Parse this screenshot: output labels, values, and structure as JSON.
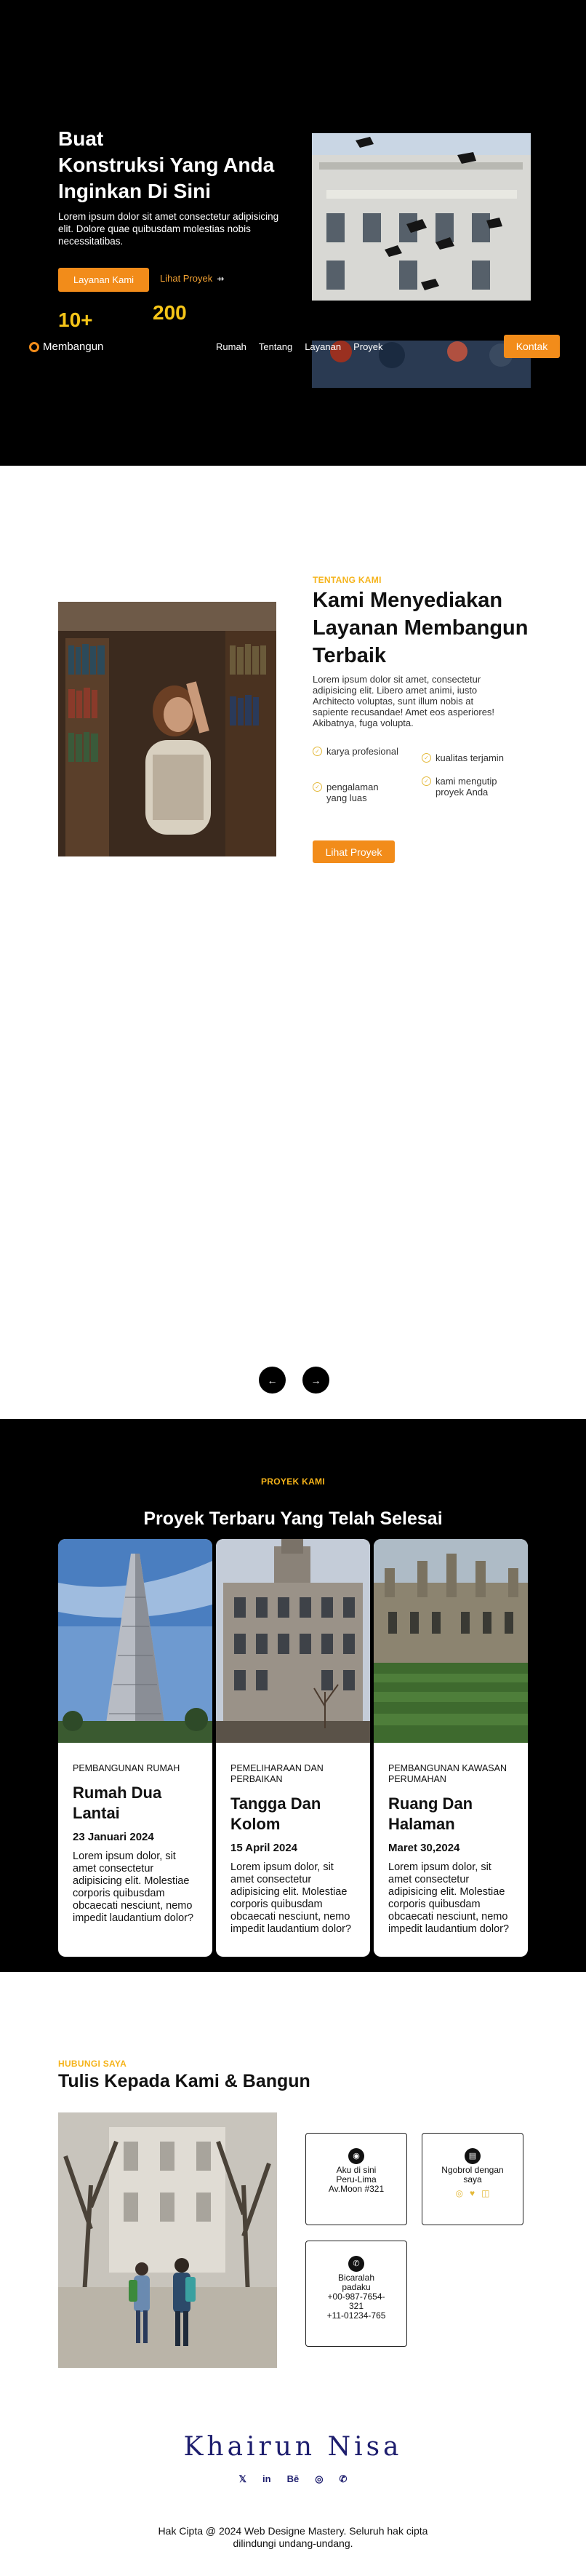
{
  "hero": {
    "title_lines": [
      "Buat",
      "Konstruksi Yang Anda",
      "Inginkan Di Sini"
    ],
    "description": "Lorem ipsum dolor sit amet consectetur adipisicing elit. Dolore quae quibusdam molestias nobis necessitatibas.",
    "primary_button": "Layanan Kami",
    "secondary_link": "Lihat Proyek",
    "stats": [
      "10+",
      "200"
    ]
  },
  "navbar": {
    "brand": "Membangun",
    "links": [
      "Rumah",
      "Tentang",
      "Layanan",
      "Proyek"
    ],
    "cta": "Kontak"
  },
  "about": {
    "eyebrow": "TENTANG KAMI",
    "title": "Kami Menyediakan Layanan Membangun Terbaik",
    "description": "Lorem ipsum dolor sit amet, consectetur adipisicing elit. Libero amet animi, iusto Architecto voluptas, sunt illum nobis at sapiente recusandae! Amet eos asperiores! Akibatnya, fuga volupta.",
    "features": [
      "karya profesional",
      "kualitas terjamin",
      "pengalaman yang luas",
      "kami mengutip proyek Anda"
    ],
    "button": "Lihat Proyek"
  },
  "carousel": {
    "prev": "←",
    "next": "→"
  },
  "projects": {
    "eyebrow": "PROYEK KAMI",
    "title": "Proyek Terbaru Yang Telah Selesai",
    "cards": [
      {
        "category": "PEMBANGUNAN RUMAH",
        "title": "Rumah Dua Lantai",
        "date": "23 Januari 2024",
        "description": "Lorem ipsum dolor, sit amet consectetur adipisicing elit. Molestiae corporis quibusdam obcaecati nesciunt, nemo impedit laudantium dolor?"
      },
      {
        "category": "PEMELIHARAAN DAN PERBAIKAN",
        "title": "Tangga Dan Kolom",
        "date": "15 April 2024",
        "description": "Lorem ipsum dolor, sit amet consectetur adipisicing elit. Molestiae corporis quibusdam obcaecati nesciunt, nemo impedit laudantium dolor?"
      },
      {
        "category": "PEMBANGUNAN KAWASAN PERUMAHAN",
        "title": "Ruang Dan Halaman",
        "date": "Maret 30,2024",
        "description": "Lorem ipsum dolor, sit amet consectetur adipisicing elit. Molestiae corporis quibusdam obcaecati nesciunt, nemo impedit laudantium dolor?"
      }
    ]
  },
  "contact": {
    "eyebrow": "HUBUNGI SAYA",
    "title": "Tulis Kepada Kami & Bangun",
    "boxes": [
      {
        "icon": "map-pin-icon",
        "lines": [
          "Aku di sini",
          "Peru-Lima",
          "Av.Moon #321"
        ]
      },
      {
        "icon": "chat-icon",
        "lines": [
          "Ngobrol dengan",
          "saya"
        ]
      },
      {
        "icon": "phone-icon",
        "lines": [
          "Bicaralah",
          "padaku",
          "+00-987-7654-",
          "321",
          "+11-01234-765"
        ]
      }
    ]
  },
  "footer": {
    "name": "Khairun Nisa",
    "socials": [
      "twitter-icon",
      "linkedin-icon",
      "behance-icon",
      "instagram-icon",
      "whatsapp-icon"
    ],
    "copyright_lines": [
      "Hak Cipta @ 2024 Web Designe Mastery. Seluruh hak cipta",
      "dilindungi undang-undang."
    ]
  },
  "colors": {
    "accent": "#f28c1a",
    "gold": "#f5c518",
    "dark": "#000000",
    "footer_name": "#1e1e6e"
  }
}
